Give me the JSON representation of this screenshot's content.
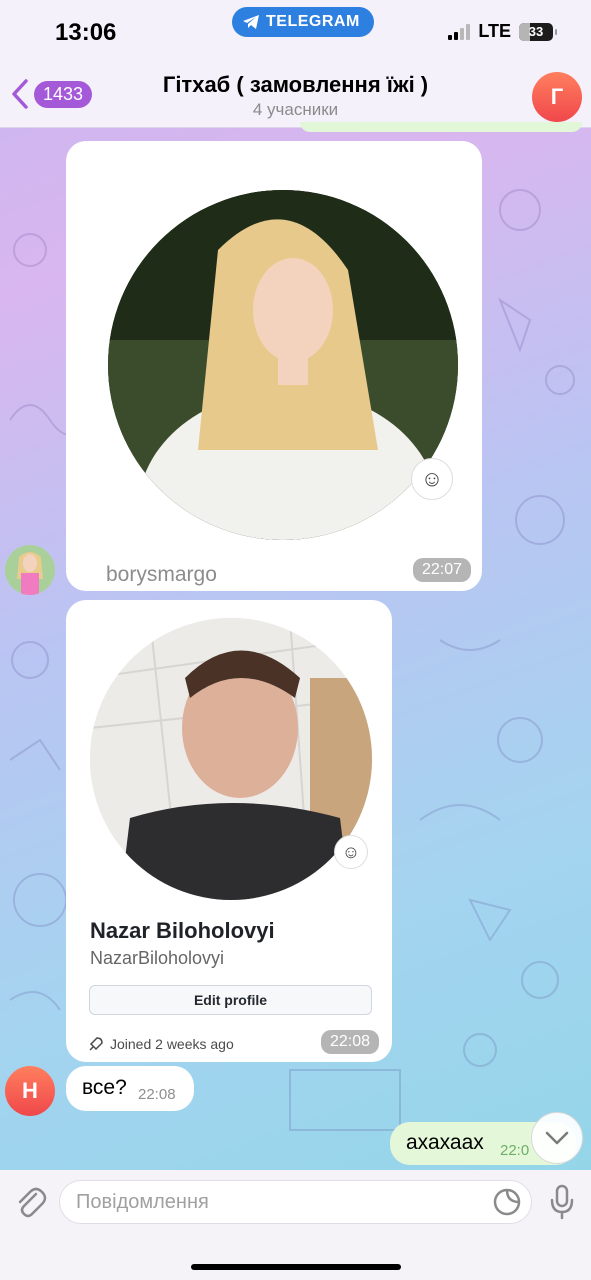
{
  "status_bar": {
    "time": "13:06",
    "app_pill": "TELEGRAM",
    "network": "LTE",
    "battery": "33",
    "battery_level_percent": 33
  },
  "header": {
    "back_count": "1433",
    "title": "Гітхаб ( замовлення їжі )",
    "subtitle": "4 учасники",
    "avatar_letter": "Г"
  },
  "messages": [
    {
      "type": "photo",
      "caption": "borysmargo",
      "time": "22:07",
      "icon": "smiley-icon"
    },
    {
      "type": "profile-card",
      "name": "Nazar Biloholovyi",
      "username": "NazarBiloholovyi",
      "button_label": "Edit profile",
      "joined": "Joined 2 weeks ago",
      "time": "22:08",
      "icon": "smiley-icon"
    },
    {
      "type": "text",
      "sender_letter": "Н",
      "text": "все?",
      "time": "22:08"
    },
    {
      "type": "text-own",
      "text": "ахахаах",
      "time": "22:0"
    }
  ],
  "composer": {
    "placeholder": "Повідомлення"
  },
  "colors": {
    "accent": "#a45ad8",
    "telegram_blue": "#2d7fe0",
    "avatar_red": "#f0474b",
    "own_bubble": "#e4f8d9"
  }
}
